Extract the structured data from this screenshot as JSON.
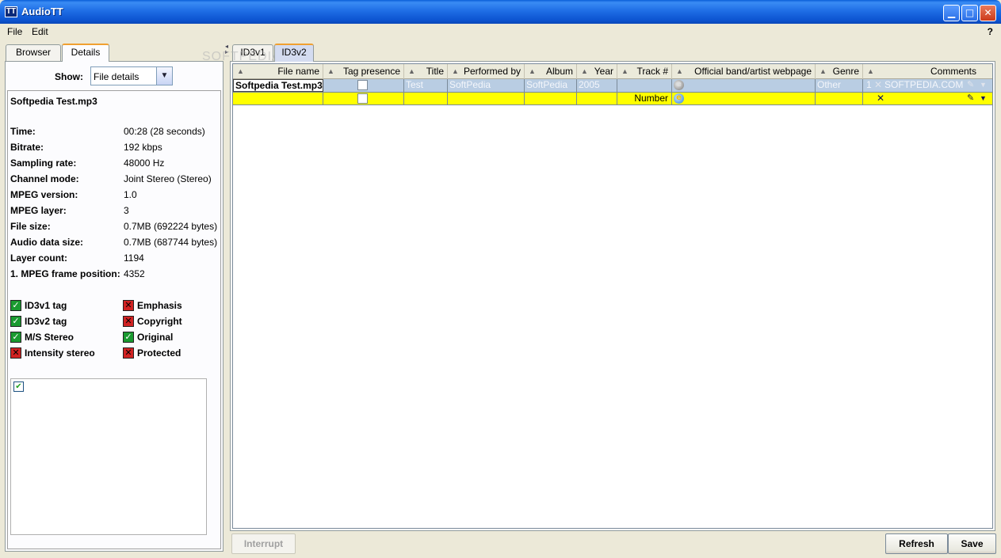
{
  "window": {
    "title": "AudioTT",
    "logo_glyph": "TT",
    "min_glyph": "▁",
    "max_glyph": "□",
    "close_glyph": "✕"
  },
  "menu": {
    "file": "File",
    "edit": "Edit",
    "help": "?"
  },
  "left": {
    "tabs": [
      "Browser",
      "Details"
    ],
    "active_tab": "Details",
    "show_label": "Show:",
    "show_value": "File details",
    "show_arrow": "▼",
    "file_name": "Softpedia Test.mp3",
    "properties": [
      {
        "label": "Time:",
        "value": "00:28 (28 seconds)"
      },
      {
        "label": "Bitrate:",
        "value": "192 kbps"
      },
      {
        "label": "Sampling rate:",
        "value": "48000 Hz"
      },
      {
        "label": "Channel mode:",
        "value": "Joint Stereo (Stereo)"
      },
      {
        "label": "MPEG version:",
        "value": "1.0"
      },
      {
        "label": "MPEG layer:",
        "value": "3"
      },
      {
        "label": "File size:",
        "value": "0.7MB (692224 bytes)"
      },
      {
        "label": "Audio data size:",
        "value": "0.7MB (687744 bytes)"
      },
      {
        "label": "Layer count:",
        "value": "1194"
      },
      {
        "label": "1. MPEG frame position:",
        "value": "4352"
      }
    ],
    "flags": [
      {
        "label": "ID3v1 tag",
        "state": true
      },
      {
        "label": "Emphasis",
        "state": false
      },
      {
        "label": "ID3v2 tag",
        "state": true
      },
      {
        "label": "Copyright",
        "state": false
      },
      {
        "label": "M/S Stereo",
        "state": true
      },
      {
        "label": "Original",
        "state": true
      },
      {
        "label": "Intensity stereo",
        "state": false
      },
      {
        "label": "Protected",
        "state": false
      }
    ],
    "ok_glyph": "✓",
    "bad_glyph": "✕",
    "mini_check_glyph": "✔"
  },
  "right": {
    "tabs": [
      "ID3v1",
      "ID3v2"
    ],
    "active_tab": "ID3v2",
    "sort_glyph": "▲",
    "columns": [
      "File name",
      "Tag presence",
      "Title",
      "Performed by",
      "Album",
      "Year",
      "Track #",
      "Official band/artist webpage",
      "Genre",
      "Comments"
    ],
    "row1": {
      "file_name": "Softpedia Test.mp3",
      "title": "Test",
      "performer": "SoftPedia",
      "album": "SoftPedia",
      "year": "2005",
      "genre": "Other",
      "comment_num": "1",
      "comment_text": "SOFTPEDIA.COM"
    },
    "row2": {
      "track": "Number"
    },
    "ie_glyph": "e",
    "x_glyph": "✕",
    "pen_glyph": "✎",
    "caret_glyph": "▼",
    "watermark": "SOFTPEDIA"
  },
  "buttons": {
    "interrupt": "Interrupt",
    "refresh": "Refresh",
    "save": "Save"
  },
  "colors": {
    "titlebar": "#0a5fd8",
    "selection_row": "#b9cde3",
    "edit_row": "#ffff00",
    "ok": "#1a9a30",
    "bad": "#d02222"
  }
}
